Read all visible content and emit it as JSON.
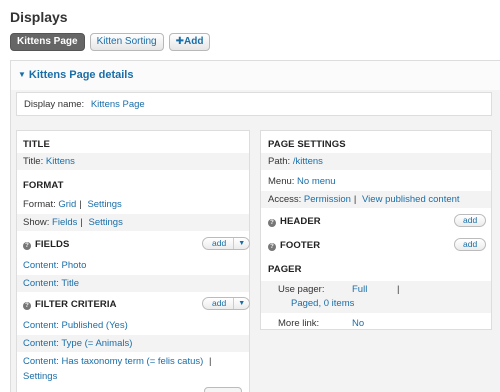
{
  "page": {
    "title": "Displays"
  },
  "tabs": [
    {
      "label": "Kittens Page",
      "active": true
    },
    {
      "label": "Kitten Sorting",
      "active": false
    },
    {
      "label": "Add",
      "icon": "plus-icon"
    }
  ],
  "details": {
    "title": "Kittens Page details",
    "display_name_label": "Display name:",
    "display_name_value": "Kittens Page"
  },
  "left": {
    "title_section": {
      "heading": "TITLE",
      "label": "Title:",
      "value": "Kittens"
    },
    "format_section": {
      "heading": "FORMAT",
      "format_label": "Format:",
      "format_value": "Grid",
      "format_settings": "Settings",
      "show_label": "Show:",
      "show_value": "Fields",
      "show_settings": "Settings"
    },
    "fields_section": {
      "heading": "FIELDS",
      "add_label": "add",
      "items": [
        "Content: Photo",
        "Content: Title"
      ]
    },
    "filter_section": {
      "heading": "FILTER CRITERIA",
      "add_label": "add",
      "items": [
        "Content: Published (Yes)",
        "Content: Type (= Animals)",
        "Content: Has taxonomy term (= felis catus)"
      ],
      "last_settings": "Settings"
    }
  },
  "right": {
    "page_settings": {
      "heading": "PAGE SETTINGS",
      "path_label": "Path:",
      "path_value": "/kittens",
      "menu_label": "Menu:",
      "menu_value": "No menu",
      "access_label": "Access:",
      "access_value": "Permission",
      "access_extra": "View published content"
    },
    "header_section": {
      "heading": "HEADER",
      "add_label": "add"
    },
    "footer_section": {
      "heading": "FOOTER",
      "add_label": "add"
    },
    "pager_section": {
      "heading": "PAGER",
      "use_pager_label": "Use pager:",
      "use_pager_value": "Full",
      "use_pager_extra": "Paged, 0 items",
      "more_link_label": "More link:",
      "more_link_value": "No"
    }
  },
  "icons": {
    "help": "question-icon",
    "caret": "chevron-down-icon",
    "collapse": "triangle-down-icon"
  },
  "colors": {
    "link": "#1a6ea8",
    "active_tab": "#666666",
    "panel_bg": "#f3f3f3"
  }
}
